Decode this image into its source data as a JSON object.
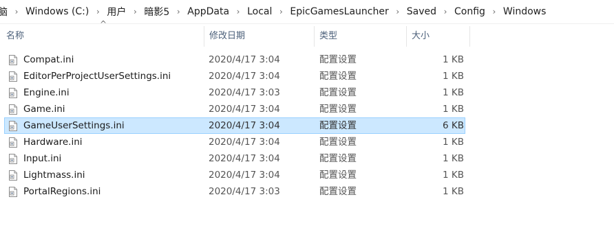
{
  "breadcrumb": [
    "脑",
    "Windows (C:)",
    "用户",
    "暗影5",
    "AppData",
    "Local",
    "EpicGamesLauncher",
    "Saved",
    "Config",
    "Windows"
  ],
  "columns": {
    "name": "名称",
    "date": "修改日期",
    "type": "类型",
    "size": "大小",
    "sort_indicator": "^"
  },
  "files": [
    {
      "name": "Compat.ini",
      "date": "2020/4/17 3:04",
      "type": "配置设置",
      "size": "1 KB",
      "selected": false
    },
    {
      "name": "EditorPerProjectUserSettings.ini",
      "date": "2020/4/17 3:04",
      "type": "配置设置",
      "size": "1 KB",
      "selected": false
    },
    {
      "name": "Engine.ini",
      "date": "2020/4/17 3:03",
      "type": "配置设置",
      "size": "1 KB",
      "selected": false
    },
    {
      "name": "Game.ini",
      "date": "2020/4/17 3:04",
      "type": "配置设置",
      "size": "1 KB",
      "selected": false
    },
    {
      "name": "GameUserSettings.ini",
      "date": "2020/4/17 3:04",
      "type": "配置设置",
      "size": "6 KB",
      "selected": true
    },
    {
      "name": "Hardware.ini",
      "date": "2020/4/17 3:04",
      "type": "配置设置",
      "size": "1 KB",
      "selected": false
    },
    {
      "name": "Input.ini",
      "date": "2020/4/17 3:04",
      "type": "配置设置",
      "size": "1 KB",
      "selected": false
    },
    {
      "name": "Lightmass.ini",
      "date": "2020/4/17 3:04",
      "type": "配置设置",
      "size": "1 KB",
      "selected": false
    },
    {
      "name": "PortalRegions.ini",
      "date": "2020/4/17 3:03",
      "type": "配置设置",
      "size": "1 KB",
      "selected": false
    }
  ],
  "icons": {
    "file": "ini-file-icon"
  },
  "colors": {
    "selection_bg": "#cce8ff",
    "selection_border": "#99d1ff",
    "header_text": "#4c607a"
  }
}
